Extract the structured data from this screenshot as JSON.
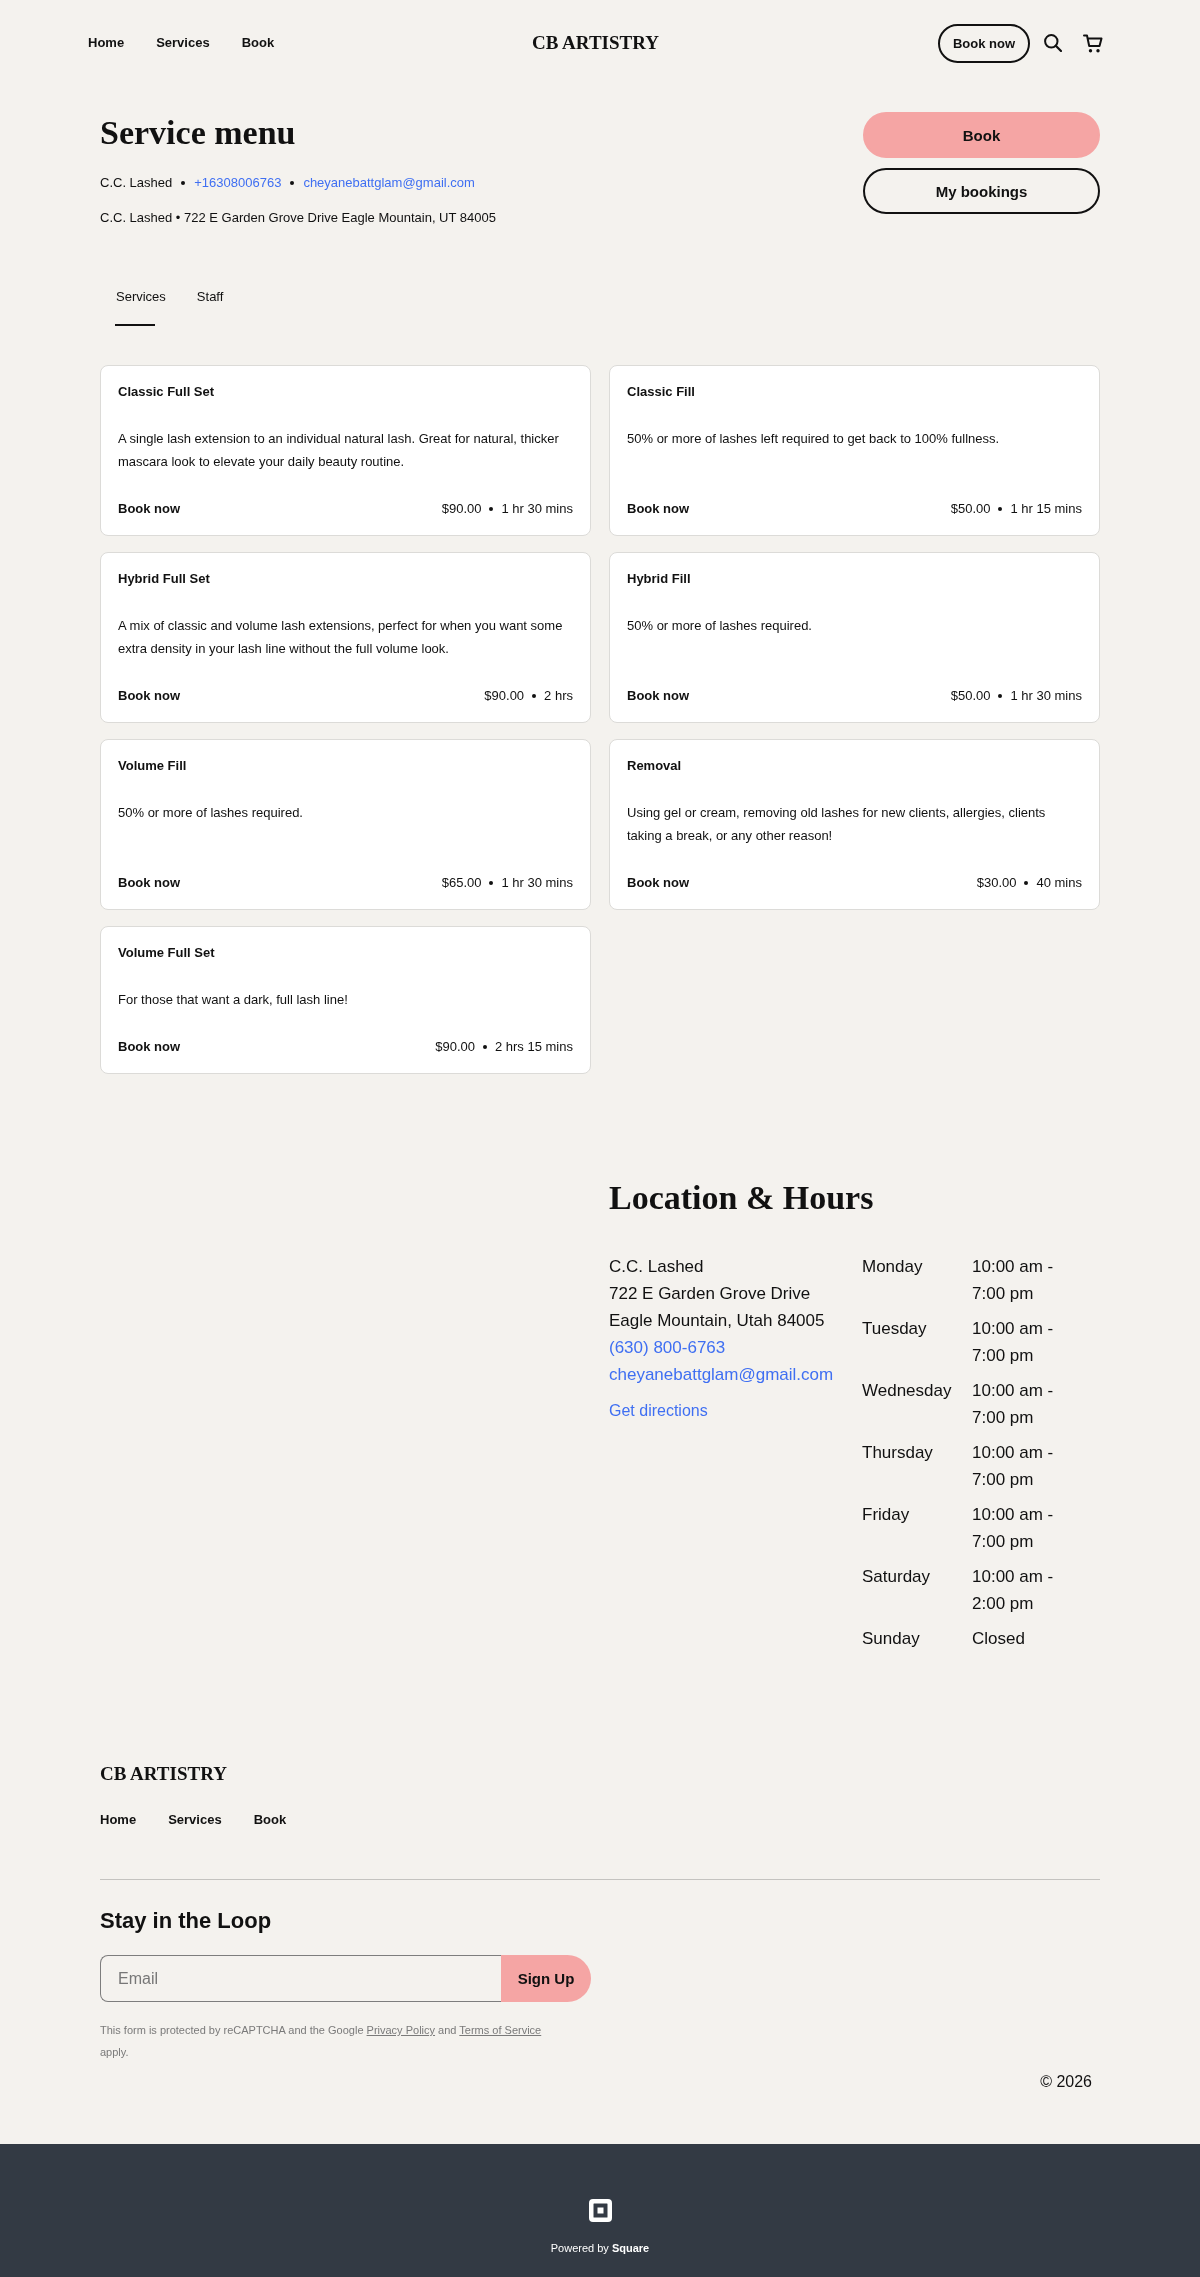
{
  "header": {
    "nav": [
      "Home",
      "Services",
      "Book"
    ],
    "logo": "CB ARTISTRY",
    "book_button": "Book now"
  },
  "service_menu": {
    "title": "Service menu",
    "contact": {
      "name": "C.C. Lashed",
      "phone": "+16308006763",
      "email": "cheyanebattglam@gmail.com"
    },
    "address": "C.C. Lashed • 722 E Garden Grove Drive Eagle Mountain, UT 84005",
    "buttons": [
      {
        "label": "Book",
        "kind": "primary"
      },
      {
        "label": "My bookings",
        "kind": "secondary"
      }
    ],
    "tabs": [
      {
        "label": "Services",
        "selected": true
      },
      {
        "label": "Staff",
        "selected": false
      }
    ],
    "services": [
      {
        "name": "Classic Full Set",
        "description": "A single lash extension to an individual natural lash. Great for natural, thicker mascara look to elevate your daily beauty routine.",
        "action": "Book now",
        "price": "$90.00",
        "duration": "1 hr 30 mins"
      },
      {
        "name": "Classic Fill",
        "description": "50% or more of lashes left required to get back to 100% fullness.",
        "action": "Book now",
        "price": "$50.00",
        "duration": "1 hr 15 mins"
      },
      {
        "name": "Hybrid Full Set",
        "description": "A mix of classic and volume lash extensions, perfect for when you want some extra density in your lash line without the full volume look.",
        "action": "Book now",
        "price": "$90.00",
        "duration": "2 hrs"
      },
      {
        "name": "Hybrid Fill",
        "description": "50% or more of lashes required.",
        "action": "Book now",
        "price": "$50.00",
        "duration": "1 hr 30 mins"
      },
      {
        "name": "Volume Fill",
        "description": "50% or more of lashes required.",
        "action": "Book now",
        "price": "$65.00",
        "duration": "1 hr 30 mins"
      },
      {
        "name": "Removal",
        "description": "Using gel or cream, removing old lashes for new clients, allergies, clients taking a break, or any other reason!",
        "action": "Book now",
        "price": "$30.00",
        "duration": "40 mins"
      },
      {
        "name": "Volume Full Set",
        "description": "For those that want a dark, full lash line!",
        "action": "Book now",
        "price": "$90.00",
        "duration": "2 hrs 15 mins"
      }
    ]
  },
  "location": {
    "title": "Location & Hours",
    "address_lines": [
      "C.C. Lashed",
      "722 E Garden Grove Drive",
      "Eagle Mountain, Utah 84005"
    ],
    "phone": "(630) 800-6763",
    "email": "cheyanebattglam@gmail.com",
    "directions": "Get directions",
    "hours": [
      {
        "day": "Monday",
        "time": "10:00 am - 7:00 pm"
      },
      {
        "day": "Tuesday",
        "time": "10:00 am - 7:00 pm"
      },
      {
        "day": "Wednesday",
        "time": "10:00 am - 7:00 pm"
      },
      {
        "day": "Thursday",
        "time": "10:00 am - 7:00 pm"
      },
      {
        "day": "Friday",
        "time": "10:00 am - 7:00 pm"
      },
      {
        "day": "Saturday",
        "time": "10:00 am - 2:00 pm"
      },
      {
        "day": "Sunday",
        "time": "Closed"
      }
    ]
  },
  "footer": {
    "logo": "CB ARTISTRY",
    "nav": [
      "Home",
      "Services",
      "Book"
    ],
    "newsletter": {
      "title": "Stay in the Loop",
      "placeholder": "Email",
      "button": "Sign Up",
      "legal": [
        {
          "kind": "text",
          "text": "This form is protected by reCAPTCHA and the Google "
        },
        {
          "kind": "link",
          "text": "Privacy Policy"
        },
        {
          "kind": "text",
          "text": " and "
        },
        {
          "kind": "link",
          "text": "Terms of Service"
        },
        {
          "kind": "text",
          "text": " apply."
        }
      ]
    },
    "copyright": "© 2026"
  },
  "footer_bar": {
    "powered_by": "Powered by **Square**"
  }
}
